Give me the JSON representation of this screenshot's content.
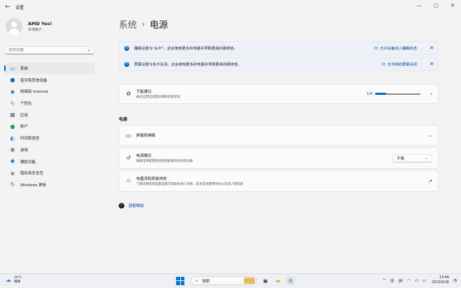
{
  "window": {
    "title": "设置",
    "back_icon": "arrow-left-icon",
    "controls": {
      "minimize": "—",
      "maximize": "▢",
      "close": "✕"
    }
  },
  "profile": {
    "name": "AMD Yes!",
    "account": "本地帐户"
  },
  "search": {
    "placeholder": "查找设置",
    "icon": "search-icon"
  },
  "nav": [
    {
      "label": "系统",
      "icon": "▭",
      "icon_name": "system-icon",
      "color": "#0078d4",
      "active": true
    },
    {
      "label": "蓝牙和其他设备",
      "icon": "●",
      "icon_name": "bluetooth-icon",
      "color": "#0067c0"
    },
    {
      "label": "网络和 Internet",
      "icon": "◆",
      "icon_name": "network-icon",
      "color": "#3a7bd5"
    },
    {
      "label": "个性化",
      "icon": "✎",
      "icon_name": "personalization-icon",
      "color": "#c66a1a"
    },
    {
      "label": "应用",
      "icon": "▦",
      "icon_name": "apps-icon",
      "color": "#5b6b80"
    },
    {
      "label": "帐户",
      "icon": "●",
      "icon_name": "accounts-icon",
      "color": "#1e9e5a"
    },
    {
      "label": "时间和语言",
      "icon": "◐",
      "icon_name": "time-language-icon",
      "color": "#2a7fd6"
    },
    {
      "label": "游戏",
      "icon": "◉",
      "icon_name": "gaming-icon",
      "color": "#7a7a7a"
    },
    {
      "label": "辅助功能",
      "icon": "✱",
      "icon_name": "accessibility-icon",
      "color": "#1b6bc0"
    },
    {
      "label": "隐私和安全性",
      "icon": "◈",
      "icon_name": "privacy-shield-icon",
      "color": "#6b6b6b"
    },
    {
      "label": "Windows 更新",
      "icon": "↻",
      "icon_name": "windows-update-icon",
      "color": "#0078d4"
    }
  ],
  "breadcrumb": {
    "parent": "系统",
    "separator": "›",
    "current": "电源"
  },
  "infobars": [
    {
      "text": "睡眠设置为\"从不\"，这会使用更多的电量并导致更高的碳排放。",
      "link": "允许设备进入睡眠状态",
      "link_icon": "sleep-link-icon",
      "close": "✕"
    },
    {
      "text": "屏幕设置为永不关闭。这会使用更多的电量并导致更高的碳排放。",
      "link": "允许我的屏幕关闭",
      "link_icon": "screen-link-icon",
      "close": "✕"
    }
  ],
  "energy_card": {
    "title": "节能建议",
    "desc": "通过应用自选建议来降低碳足迹",
    "progress_label": "1/4",
    "progress": 0.25,
    "chevron": "›"
  },
  "section_title": "电源",
  "cards": [
    {
      "title": "屏幕和睡眠",
      "desc": "",
      "icon": "▭",
      "icon_name": "screen-sleep-icon",
      "right": "⌄"
    },
    {
      "title": "电源模式",
      "desc": "根据电源使用情况和性能来优化你的设备",
      "icon": "↺",
      "icon_name": "power-mode-icon",
      "dropdown": "平衡"
    },
    {
      "title": "电量消耗和碳排放",
      "desc": "了解选择较低电量设置可帮助你减少功耗、延长电池使用时间以及减少碳排放",
      "icon": "♲",
      "icon_name": "energy-carbon-icon",
      "right": "↗"
    }
  ],
  "help": {
    "label": "获取帮助",
    "icon": "?"
  },
  "taskbar": {
    "weather_temp": "34°C",
    "weather_desc": "晴朗",
    "search_label": "搜索",
    "time": "13:44",
    "date": "2023/6/18",
    "tray_chevron": "^",
    "lang": "中",
    "input_mode": "拼"
  }
}
